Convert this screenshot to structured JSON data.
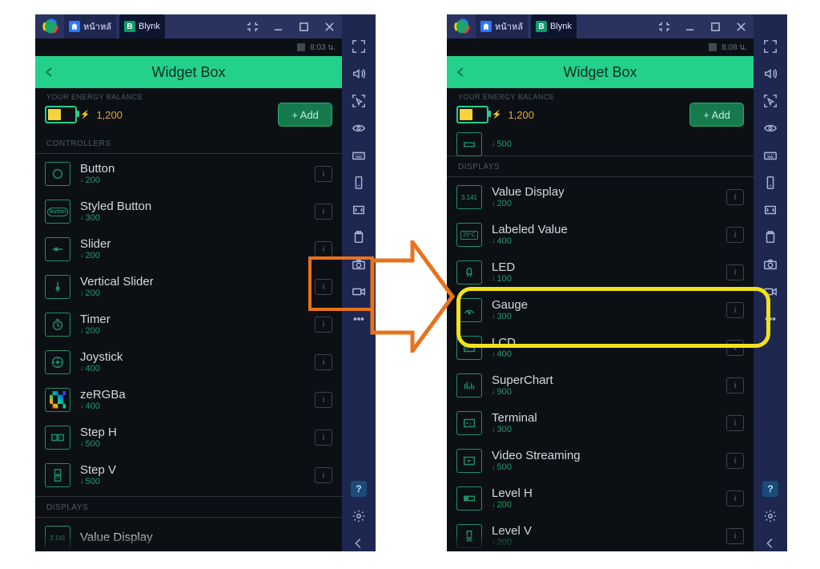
{
  "titlebar": {
    "home_label": "หน้าหลั",
    "app_label": "Blynk",
    "app_badge": "B"
  },
  "statusbar": {
    "time_left": "8:03 น.",
    "time_right": "8:08 น."
  },
  "header": {
    "title": "Widget Box"
  },
  "energy": {
    "label": "YOUR ENERGY BALANCE",
    "value": "1,200",
    "add_label": "+ Add"
  },
  "sections": {
    "controllers": "CONTROLLERS",
    "displays": "DISPLAYS"
  },
  "left_partial": {
    "name": "—",
    "cost": "500"
  },
  "left_widgets": [
    {
      "name": "Button",
      "cost": "200",
      "icon": "circle"
    },
    {
      "name": "Styled Button",
      "cost": "300",
      "icon": "styled"
    },
    {
      "name": "Slider",
      "cost": "200",
      "icon": "slider-h"
    },
    {
      "name": "Vertical Slider",
      "cost": "200",
      "icon": "slider-v"
    },
    {
      "name": "Timer",
      "cost": "200",
      "icon": "timer"
    },
    {
      "name": "Joystick",
      "cost": "400",
      "icon": "joystick"
    },
    {
      "name": "zeRGBa",
      "cost": "400",
      "icon": "zergba"
    },
    {
      "name": "Step H",
      "cost": "500",
      "icon": "step-h"
    },
    {
      "name": "Step V",
      "cost": "500",
      "icon": "step-v"
    }
  ],
  "left_tail": {
    "name": "Value Display",
    "icon": "value"
  },
  "right_widgets": [
    {
      "name": "Value Display",
      "cost": "200",
      "icon": "value"
    },
    {
      "name": "Labeled Value",
      "cost": "400",
      "icon": "labeled"
    },
    {
      "name": "LED",
      "cost": "100",
      "icon": "led"
    },
    {
      "name": "Gauge",
      "cost": "300",
      "icon": "gauge"
    },
    {
      "name": "LCD",
      "cost": "400",
      "icon": "lcd"
    },
    {
      "name": "SuperChart",
      "cost": "900",
      "icon": "chart"
    },
    {
      "name": "Terminal",
      "cost": "300",
      "icon": "terminal"
    },
    {
      "name": "Video Streaming",
      "cost": "500",
      "icon": "video"
    },
    {
      "name": "Level H",
      "cost": "200",
      "icon": "level-h"
    },
    {
      "name": "Level V",
      "cost": "200",
      "icon": "level-v"
    }
  ],
  "info_char": "i",
  "help_char": "?"
}
